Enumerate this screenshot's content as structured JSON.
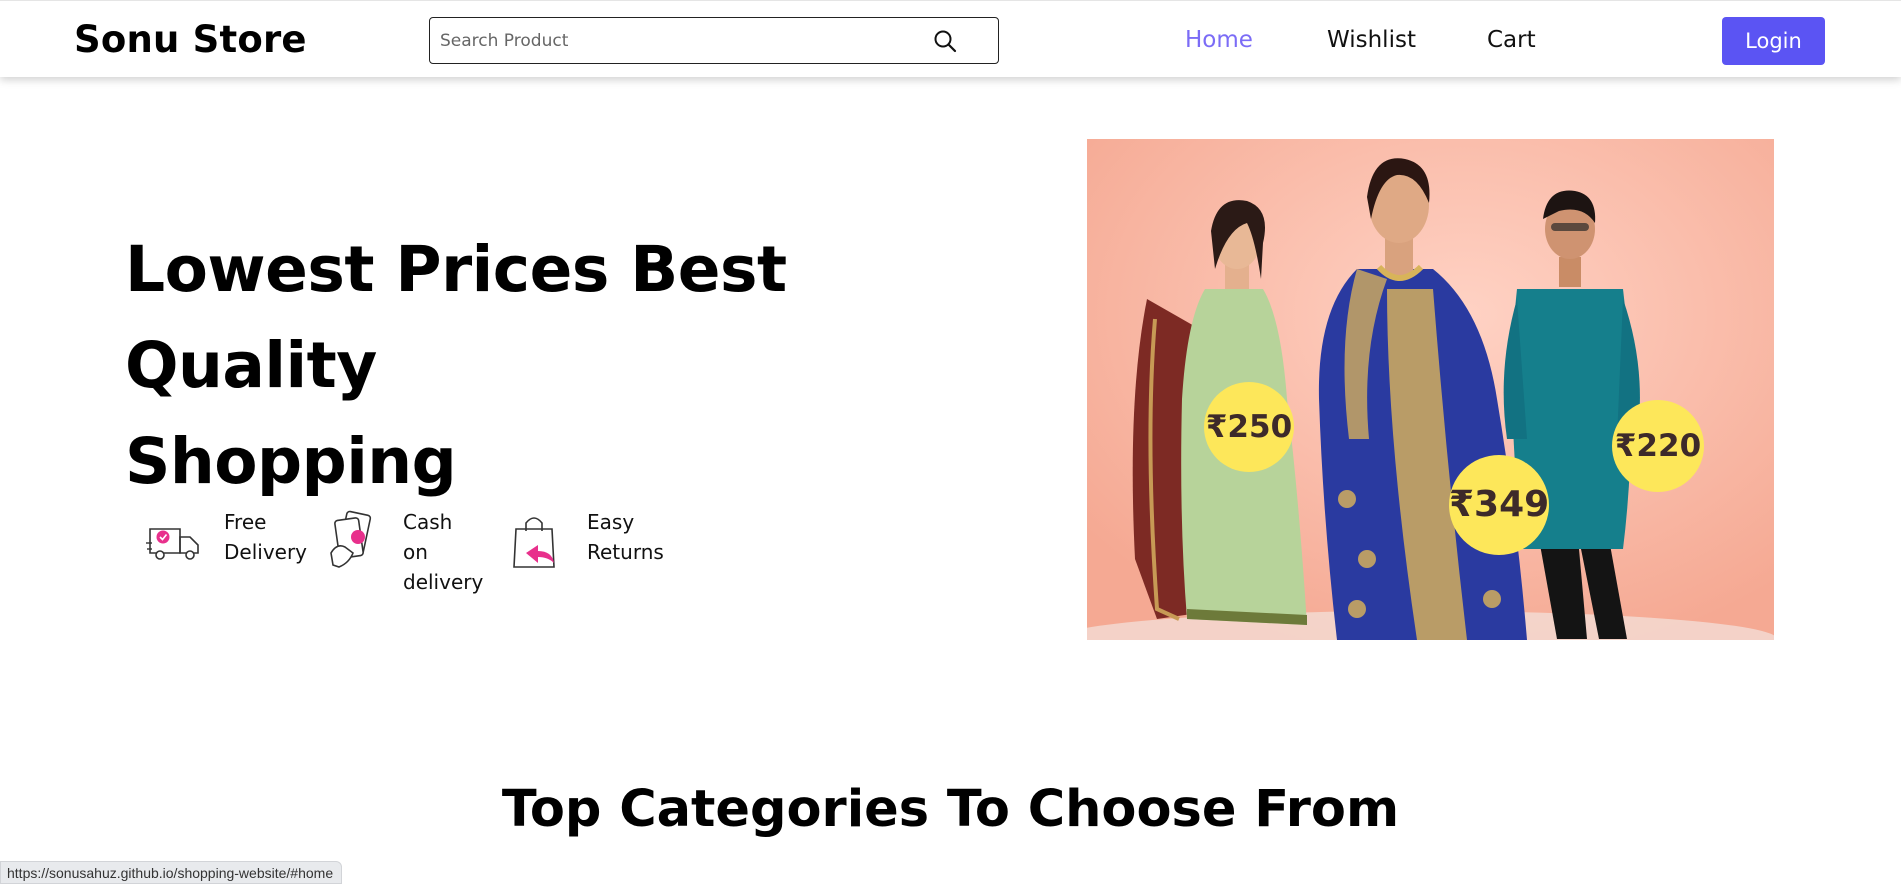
{
  "header": {
    "brand": "Sonu Store",
    "search_placeholder": "Search Product",
    "nav": [
      {
        "label": "Home",
        "active": true
      },
      {
        "label": "Wishlist",
        "active": false
      },
      {
        "label": "Cart",
        "active": false
      }
    ],
    "login_label": "Login"
  },
  "hero": {
    "title_line1": "Lowest Prices Best Quality",
    "title_line2": "Shopping",
    "features": [
      {
        "icon": "delivery-truck-icon",
        "line1": "Free",
        "line2": "Delivery"
      },
      {
        "icon": "cash-on-delivery-icon",
        "line1": "Cash on",
        "line2": "delivery"
      },
      {
        "icon": "easy-returns-icon",
        "line1": "Easy",
        "line2": "Returns"
      }
    ],
    "price_tags": [
      "₹250",
      "₹349",
      "₹220"
    ]
  },
  "sections": {
    "categories_title": "Top Categories To Choose From"
  },
  "status_bar": {
    "url": "https://sonusahuz.github.io/shopping-website/#home"
  },
  "colors": {
    "accent": "#5b54f3",
    "active_link": "#7b6cf6",
    "feature_pink": "#e8308c",
    "price_tag_yellow": "#fde75a",
    "hero_bg": "#fbb9a9"
  }
}
